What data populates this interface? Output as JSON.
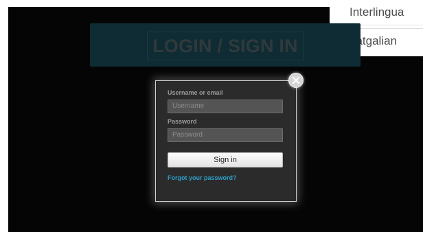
{
  "languages": [
    "Interlingua",
    "Latgalian"
  ],
  "banner": {
    "title": "LOGIN / SIGN IN"
  },
  "login": {
    "username_label": "Username or email",
    "username_placeholder": "Username",
    "password_label": "Password",
    "password_placeholder": "Password",
    "signin_label": "Sign in",
    "forgot_label": "Forgot your password?"
  },
  "icons": {
    "close": "close-icon"
  },
  "colors": {
    "accent": "#2f9ec9",
    "banner": "#0f2c34",
    "modal": "#2b2b2b"
  }
}
